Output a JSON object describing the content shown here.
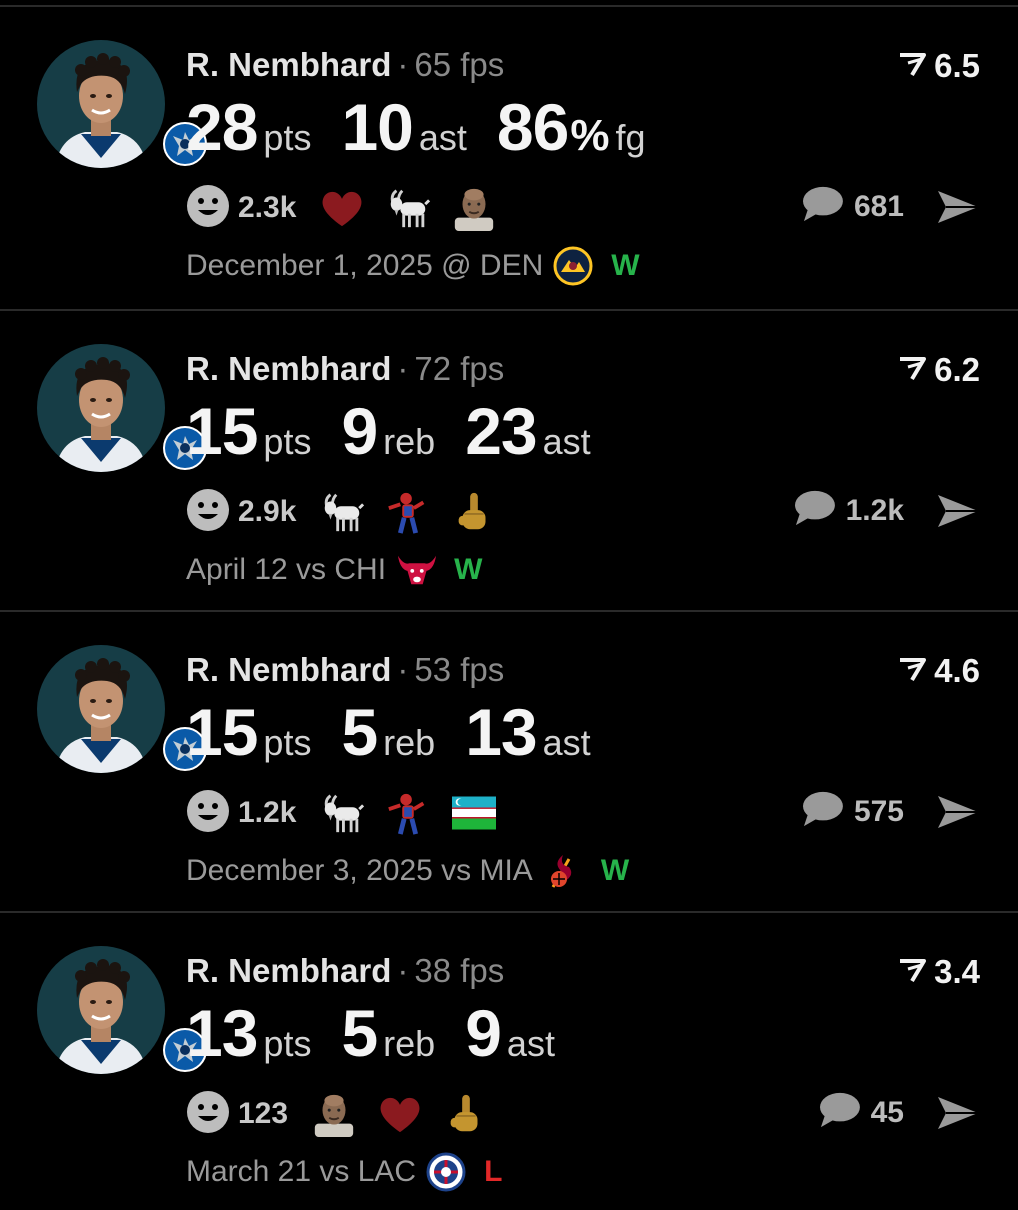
{
  "posts": [
    {
      "player": "R. Nembhard",
      "fps": "65 fps",
      "rating": "6.5",
      "stats": [
        {
          "value": "28",
          "unit": "pts",
          "pct": ""
        },
        {
          "value": "10",
          "unit": "ast",
          "pct": ""
        },
        {
          "value": "86",
          "unit": "fg",
          "pct": "%"
        }
      ],
      "reaction_count": "2.3k",
      "reaction_emojis": [
        "heart",
        "goat",
        "bald-man"
      ],
      "comment_count": "681",
      "date_opponent": "December 1, 2025 @ DEN",
      "team_logo": "nuggets-logo",
      "result": "W"
    },
    {
      "player": "R. Nembhard",
      "fps": "72 fps",
      "rating": "6.2",
      "stats": [
        {
          "value": "15",
          "unit": "pts",
          "pct": ""
        },
        {
          "value": "9",
          "unit": "reb",
          "pct": ""
        },
        {
          "value": "23",
          "unit": "ast",
          "pct": ""
        }
      ],
      "reaction_count": "2.9k",
      "reaction_emojis": [
        "goat",
        "spider-man",
        "middle-finger"
      ],
      "comment_count": "1.2k",
      "date_opponent": "April 12 vs CHI",
      "team_logo": "bulls-logo",
      "result": "W"
    },
    {
      "player": "R. Nembhard",
      "fps": "53 fps",
      "rating": "4.6",
      "stats": [
        {
          "value": "15",
          "unit": "pts",
          "pct": ""
        },
        {
          "value": "5",
          "unit": "reb",
          "pct": ""
        },
        {
          "value": "13",
          "unit": "ast",
          "pct": ""
        }
      ],
      "reaction_count": "1.2k",
      "reaction_emojis": [
        "goat",
        "spider-man",
        "uzbekistan-flag"
      ],
      "comment_count": "575",
      "date_opponent": "December 3, 2025 vs MIA",
      "team_logo": "heat-logo",
      "result": "W"
    },
    {
      "player": "R. Nembhard",
      "fps": "38 fps",
      "rating": "3.4",
      "stats": [
        {
          "value": "13",
          "unit": "pts",
          "pct": ""
        },
        {
          "value": "5",
          "unit": "reb",
          "pct": ""
        },
        {
          "value": "9",
          "unit": "ast",
          "pct": ""
        }
      ],
      "reaction_count": "123",
      "reaction_emojis": [
        "bald-man",
        "heart",
        "middle-finger"
      ],
      "comment_count": "45",
      "date_opponent": "March 21 vs LAC",
      "team_logo": "clippers-logo",
      "result": "L"
    }
  ],
  "colors": {
    "win": "#27b34b",
    "loss": "#e22828",
    "avatar_bg": "#163d46",
    "heart": "#8b1a1f"
  }
}
